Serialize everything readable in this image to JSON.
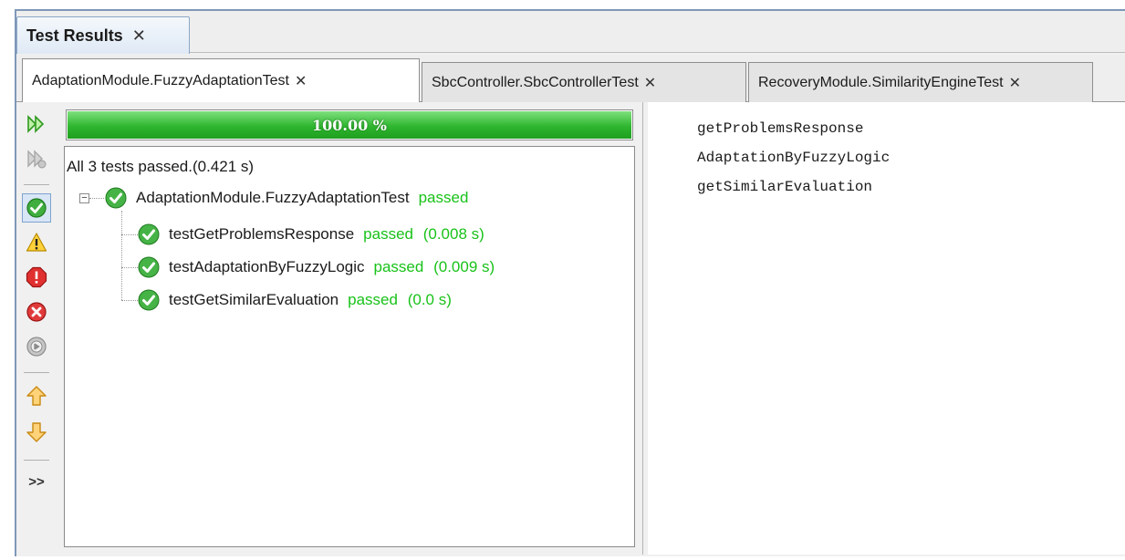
{
  "window": {
    "panel_tab": {
      "label": "Test Results",
      "close": "✕"
    }
  },
  "test_tabs": [
    {
      "label": "AdaptationModule.FuzzyAdaptationTest",
      "close": "✕",
      "active": true
    },
    {
      "label": "SbcController.SbcControllerTest",
      "close": "✕",
      "active": false
    },
    {
      "label": "RecoveryModule.SimilarityEngineTest",
      "close": "✕",
      "active": false
    }
  ],
  "toolbar": {
    "buttons": [
      {
        "icon": "rerun-icon",
        "state": "enabled"
      },
      {
        "icon": "rerun-failed-icon",
        "state": "disabled"
      },
      {
        "icon": "show-passed-icon",
        "state": "selected"
      },
      {
        "icon": "show-warnings-icon",
        "state": "enabled"
      },
      {
        "icon": "show-failures-icon",
        "state": "enabled"
      },
      {
        "icon": "show-errors-icon",
        "state": "enabled"
      },
      {
        "icon": "show-skipped-icon",
        "state": "enabled"
      },
      {
        "icon": "previous-failure-icon",
        "state": "enabled"
      },
      {
        "icon": "next-failure-icon",
        "state": "enabled"
      },
      {
        "icon": "more-icon",
        "label": ">>"
      }
    ]
  },
  "progress": {
    "value": 1.0,
    "label": "100.00 %",
    "color": "#2fb62f"
  },
  "results": {
    "summary": "All 3 tests passed.(0.421 s)",
    "suite": {
      "name": "AdaptationModule.FuzzyAdaptationTest",
      "status": "passed",
      "expander": "−"
    },
    "tests": [
      {
        "name": "testGetProblemsResponse",
        "status": "passed",
        "time": "(0.008 s)"
      },
      {
        "name": "testAdaptationByFuzzyLogic",
        "status": "passed",
        "time": "(0.009 s)"
      },
      {
        "name": "testGetSimilarEvaluation",
        "status": "passed",
        "time": "(0.0 s)"
      }
    ]
  },
  "output": {
    "lines": [
      "getProblemsResponse",
      "AdaptationByFuzzyLogic",
      "getSimilarEvaluation"
    ]
  },
  "colors": {
    "passed": "#19c219",
    "tab_border": "#8da7c6"
  }
}
